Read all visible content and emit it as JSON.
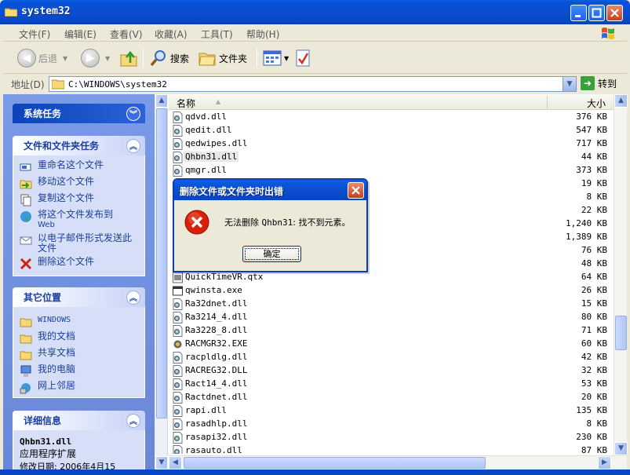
{
  "window": {
    "title": "system32"
  },
  "menu": [
    "文件(F)",
    "编辑(E)",
    "查看(V)",
    "收藏(A)",
    "工具(T)",
    "帮助(H)"
  ],
  "toolbar": {
    "back": "后退",
    "search": "搜索",
    "folders": "文件夹"
  },
  "address": {
    "label": "地址(D)",
    "path": "C:\\WINDOWS\\system32",
    "go": "转到"
  },
  "leftpane": {
    "system_tasks": "系统任务",
    "file_tasks": {
      "title": "文件和文件夹任务",
      "items": [
        "重命名这个文件",
        "移动这个文件",
        "复制这个文件",
        "将这个文件发布到",
        "Web",
        "以电子邮件形式发送此文件",
        "删除这个文件"
      ]
    },
    "other_places": {
      "title": "其它位置",
      "items": [
        "WINDOWS",
        "我的文档",
        "共享文档",
        "我的电脑",
        "网上邻居"
      ]
    },
    "details": {
      "title": "详细信息",
      "name": "Qhbn31.dll",
      "type": "应用程序扩展",
      "modified": "修改日期: 2006年4月15"
    }
  },
  "columns": {
    "name": "名称",
    "size": "大小"
  },
  "files": [
    {
      "name": "qdvd.dll",
      "size": "376 KB"
    },
    {
      "name": "qedit.dll",
      "size": "547 KB"
    },
    {
      "name": "qedwipes.dll",
      "size": "717 KB"
    },
    {
      "name": "Qhbn31.dll",
      "size": "44 KB"
    },
    {
      "name": "qmgr.dll",
      "size": "373 KB"
    },
    {
      "name": "",
      "size": "19 KB"
    },
    {
      "name": "",
      "size": "8 KB"
    },
    {
      "name": "",
      "size": "22 KB"
    },
    {
      "name": "",
      "size": "1,240 KB"
    },
    {
      "name": "",
      "size": "1,389 KB"
    },
    {
      "name": "",
      "size": "76 KB"
    },
    {
      "name": "",
      "size": "48 KB"
    },
    {
      "name": "QuickTimeVR.qtx",
      "size": "64 KB"
    },
    {
      "name": "qwinsta.exe",
      "size": "26 KB"
    },
    {
      "name": "Ra32dnet.dll",
      "size": "15 KB"
    },
    {
      "name": "Ra3214_4.dll",
      "size": "80 KB"
    },
    {
      "name": "Ra3228_8.dll",
      "size": "71 KB"
    },
    {
      "name": "RACMGR32.EXE",
      "size": "60 KB"
    },
    {
      "name": "racpldlg.dll",
      "size": "42 KB"
    },
    {
      "name": "RACREG32.DLL",
      "size": "32 KB"
    },
    {
      "name": "Ract14_4.dll",
      "size": "53 KB"
    },
    {
      "name": "Ractdnet.dll",
      "size": "20 KB"
    },
    {
      "name": "rapi.dll",
      "size": "135 KB"
    },
    {
      "name": "rasadhlp.dll",
      "size": "8 KB"
    },
    {
      "name": "rasapi32.dll",
      "size": "230 KB"
    },
    {
      "name": "rasauto.dll",
      "size": "87 KB"
    }
  ],
  "dialog": {
    "title": "删除文件或文件夹时出错",
    "message_prefix": "无法删除 ",
    "message_file": "Qhbn31",
    "message_suffix": ": 找不到元素。",
    "ok": "确定"
  }
}
